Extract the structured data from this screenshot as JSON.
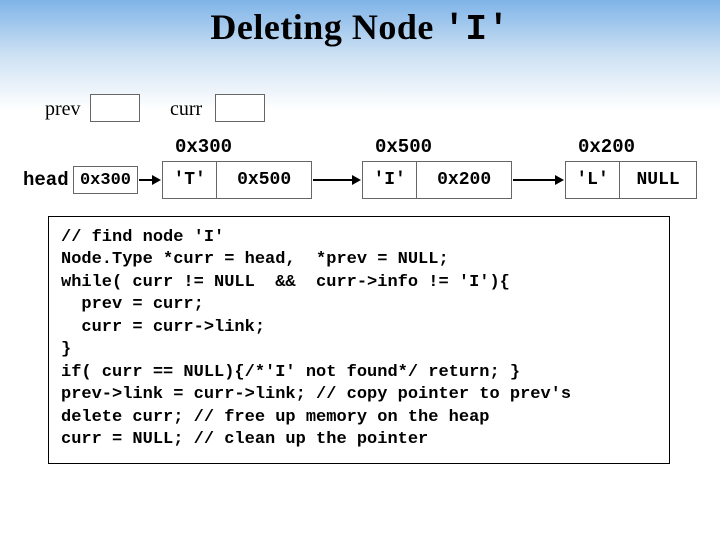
{
  "title_prefix": "Deleting Node ",
  "title_mono": "'I'",
  "labels": {
    "prev": "prev",
    "curr": "curr",
    "head": "head",
    "head_addr": "0x300"
  },
  "addresses": {
    "t": "0x300",
    "i": "0x500",
    "l": "0x200"
  },
  "nodes": {
    "t_info": "'T'",
    "t_link": "0x500",
    "i_info": "'I'",
    "i_link": "0x200",
    "l_info": "'L'",
    "l_link": "NULL"
  },
  "code": "// find node 'I'\nNode.Type *curr = head,  *prev = NULL;\nwhile( curr != NULL  &&  curr->info != 'I'){\n  prev = curr;\n  curr = curr->link;\n}\nif( curr == NULL){/*'I' not found*/ return; }\nprev->link = curr->link; // copy pointer to prev's\ndelete curr; // free up memory on the heap\ncurr = NULL; // clean up the pointer"
}
